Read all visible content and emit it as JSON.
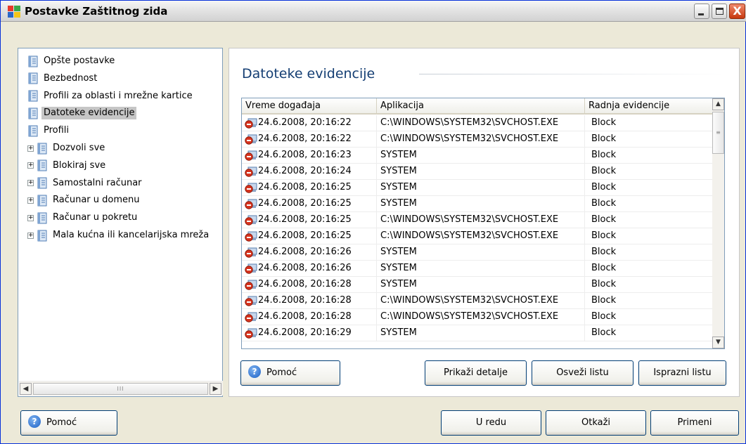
{
  "window": {
    "title": "Postavke Zaštitnog zida",
    "close_glyph": "X"
  },
  "tree": {
    "items": [
      {
        "label": "Opšte postavke"
      },
      {
        "label": "Bezbednost"
      },
      {
        "label": "Profili za oblasti i mrežne kartice"
      },
      {
        "label": "Datoteke evidencije",
        "selected": true
      },
      {
        "label": "Profili"
      },
      {
        "label": "Dozvoli sve"
      },
      {
        "label": "Blokiraj sve"
      },
      {
        "label": "Samostalni računar"
      },
      {
        "label": "Računar u domenu"
      },
      {
        "label": "Računar u pokretu"
      },
      {
        "label": "Mala kućna ili kancelarijska mreža"
      }
    ],
    "expander_glyph": "+",
    "scroll_left": "◀",
    "scroll_right": "▶",
    "thumb_grip": "III"
  },
  "panel": {
    "title": "Datoteke evidencije",
    "columns": [
      "Vreme događaja",
      "Aplikacija",
      "Radnja evidencije"
    ],
    "rows": [
      [
        "24.6.2008, 20:16:22",
        "C:\\WINDOWS\\SYSTEM32\\SVCHOST.EXE",
        "Block"
      ],
      [
        "24.6.2008, 20:16:22",
        "C:\\WINDOWS\\SYSTEM32\\SVCHOST.EXE",
        "Block"
      ],
      [
        "24.6.2008, 20:16:23",
        "SYSTEM",
        "Block"
      ],
      [
        "24.6.2008, 20:16:24",
        "SYSTEM",
        "Block"
      ],
      [
        "24.6.2008, 20:16:25",
        "SYSTEM",
        "Block"
      ],
      [
        "24.6.2008, 20:16:25",
        "SYSTEM",
        "Block"
      ],
      [
        "24.6.2008, 20:16:25",
        "C:\\WINDOWS\\SYSTEM32\\SVCHOST.EXE",
        "Block"
      ],
      [
        "24.6.2008, 20:16:25",
        "C:\\WINDOWS\\SYSTEM32\\SVCHOST.EXE",
        "Block"
      ],
      [
        "24.6.2008, 20:16:26",
        "SYSTEM",
        "Block"
      ],
      [
        "24.6.2008, 20:16:26",
        "SYSTEM",
        "Block"
      ],
      [
        "24.6.2008, 20:16:28",
        "SYSTEM",
        "Block"
      ],
      [
        "24.6.2008, 20:16:28",
        "C:\\WINDOWS\\SYSTEM32\\SVCHOST.EXE",
        "Block"
      ],
      [
        "24.6.2008, 20:16:28",
        "C:\\WINDOWS\\SYSTEM32\\SVCHOST.EXE",
        "Block"
      ],
      [
        "24.6.2008, 20:16:29",
        "SYSTEM",
        "Block"
      ]
    ],
    "scroll_up": "▲",
    "scroll_down": "▼",
    "thumb_grip": "≡",
    "buttons": {
      "help": "Pomoć",
      "details": "Prikaži detalje",
      "refresh": "Osveži listu",
      "clear": "Isprazni listu"
    }
  },
  "footer": {
    "help": "Pomoć",
    "ok": "U redu",
    "cancel": "Otkaži",
    "apply": "Primeni"
  },
  "help_glyph": "?"
}
